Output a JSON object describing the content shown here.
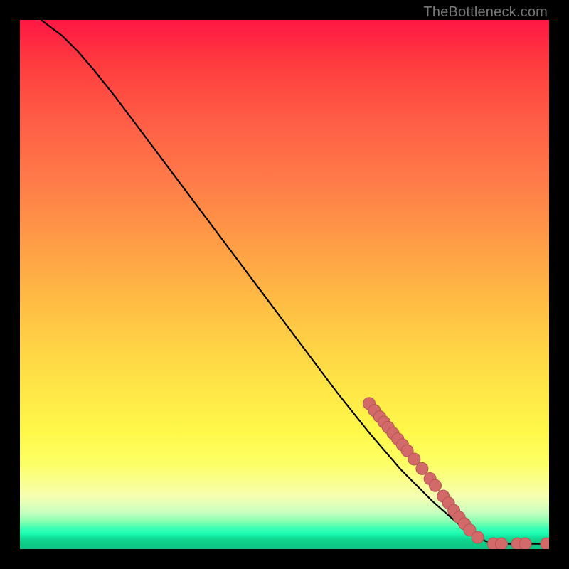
{
  "watermark": "TheBottleneck.com",
  "colors": {
    "curve": "#000000",
    "marker_fill": "#d36a6a",
    "marker_stroke": "#b85454",
    "frame_bg": "#000000"
  },
  "chart_data": {
    "type": "line",
    "title": "",
    "xlabel": "",
    "ylabel": "",
    "xlim": [
      0,
      100
    ],
    "ylim": [
      0,
      100
    ],
    "grid": false,
    "curve": [
      {
        "x": 4,
        "y": 100
      },
      {
        "x": 6,
        "y": 98.5
      },
      {
        "x": 8,
        "y": 97
      },
      {
        "x": 11,
        "y": 94
      },
      {
        "x": 14,
        "y": 90.5
      },
      {
        "x": 18,
        "y": 85.5
      },
      {
        "x": 24,
        "y": 77.5
      },
      {
        "x": 30,
        "y": 69.5
      },
      {
        "x": 36,
        "y": 61.5
      },
      {
        "x": 42,
        "y": 53.5
      },
      {
        "x": 48,
        "y": 45.5
      },
      {
        "x": 54,
        "y": 37.5
      },
      {
        "x": 60,
        "y": 29.5
      },
      {
        "x": 66,
        "y": 22.0
      },
      {
        "x": 72,
        "y": 15.0
      },
      {
        "x": 78,
        "y": 9.0
      },
      {
        "x": 82,
        "y": 5.5
      },
      {
        "x": 85,
        "y": 3.0
      },
      {
        "x": 88,
        "y": 1.5
      },
      {
        "x": 90,
        "y": 1.0
      },
      {
        "x": 94,
        "y": 1.0
      },
      {
        "x": 100,
        "y": 1.0
      }
    ],
    "series": [
      {
        "name": "markers",
        "points": [
          {
            "x": 66.0,
            "y": 27.5
          },
          {
            "x": 67.0,
            "y": 26.2
          },
          {
            "x": 68.0,
            "y": 25.0
          },
          {
            "x": 68.8,
            "y": 24.0
          },
          {
            "x": 69.6,
            "y": 23.0
          },
          {
            "x": 70.5,
            "y": 21.9
          },
          {
            "x": 71.4,
            "y": 20.8
          },
          {
            "x": 72.3,
            "y": 19.7
          },
          {
            "x": 73.2,
            "y": 18.6
          },
          {
            "x": 74.5,
            "y": 17.0
          },
          {
            "x": 76.0,
            "y": 15.2
          },
          {
            "x": 77.5,
            "y": 13.3
          },
          {
            "x": 78.5,
            "y": 12.0
          },
          {
            "x": 80.0,
            "y": 10.0
          },
          {
            "x": 81.0,
            "y": 8.7
          },
          {
            "x": 82.0,
            "y": 7.3
          },
          {
            "x": 83.0,
            "y": 6.0
          },
          {
            "x": 84.0,
            "y": 4.8
          },
          {
            "x": 85.0,
            "y": 3.6
          },
          {
            "x": 86.5,
            "y": 2.2
          },
          {
            "x": 89.5,
            "y": 1.0
          },
          {
            "x": 91.0,
            "y": 1.0
          },
          {
            "x": 94.0,
            "y": 1.0
          },
          {
            "x": 95.5,
            "y": 1.0
          },
          {
            "x": 99.5,
            "y": 1.0
          }
        ]
      }
    ]
  }
}
